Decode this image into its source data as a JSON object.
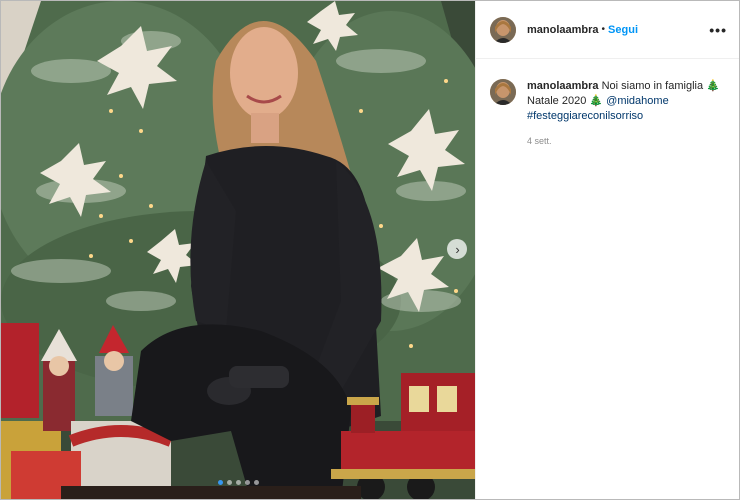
{
  "post": {
    "username": "manolaambra",
    "separator": "•",
    "follow_label": "Segui",
    "more_label": "•••",
    "next_icon": "chevron-right-icon",
    "carousel": {
      "count": 5,
      "active_index": 0
    }
  },
  "caption": {
    "username": "manolaambra",
    "text_before": " Noi siamo in famiglia ",
    "emoji": "🎄",
    "natale": "Natale 2020 ",
    "space": " ",
    "mention": "@midahome",
    "hashtag": "#festeggiareconilsorriso",
    "time": "4 sett."
  },
  "colors": {
    "link_blue": "#0095f6",
    "text_dark": "#262626",
    "muted": "#8e8e8e"
  }
}
